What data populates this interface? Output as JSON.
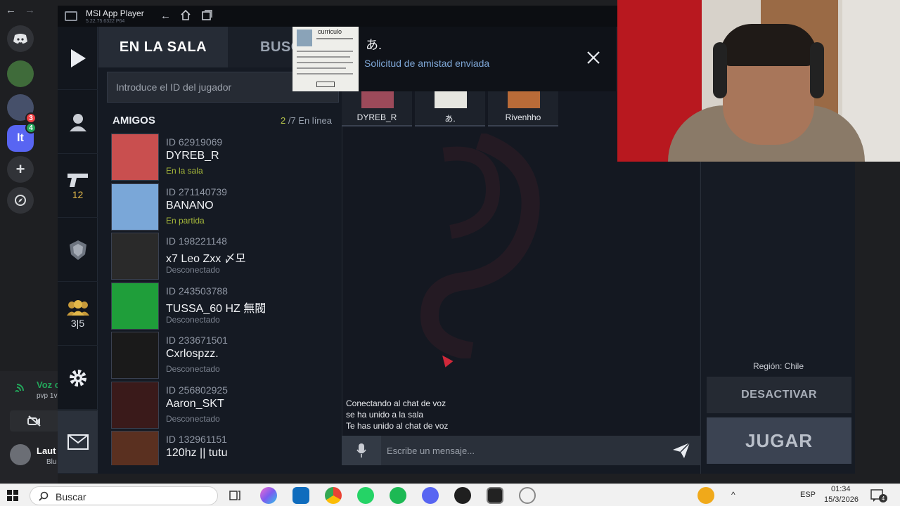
{
  "msi": {
    "title": "MSI App Player",
    "version": "5.22.75.6322 P64"
  },
  "discord": {
    "voice_title": "Voz c",
    "voice_sub": "pvp 1v",
    "user_name": "Laut",
    "user_status": "Blu"
  },
  "tabs": {
    "active": "EN LA SALA",
    "inactive": "BUSCA"
  },
  "search": {
    "placeholder": "Introduce el ID del jugador"
  },
  "rail": {
    "weapons_count": "12",
    "party_count": "3|5"
  },
  "friends": {
    "title": "AMIGOS",
    "online_current": "2",
    "online_total": "/7 En línea",
    "items": [
      {
        "id": "ID 62919069",
        "name": "DYREB_R",
        "status": "En la sala",
        "avatar_color": "#c94f4f"
      },
      {
        "id": "ID 271140739",
        "name": "BANANO",
        "status": "En partida",
        "avatar_color": "#7aa7d8"
      },
      {
        "id": "ID 198221148",
        "name": "x7 Leo Zxx 〆모",
        "status": "Desconectado",
        "avatar_color": "#2a2a2a"
      },
      {
        "id": "ID 243503788",
        "name": "TUSSA_60 HZ 無閥",
        "status": "Desconectado",
        "avatar_color": "#1f9e3a"
      },
      {
        "id": "ID 233671501",
        "name": "Cxrlospzz.",
        "status": "Desconectado",
        "avatar_color": "#1a1a1a"
      },
      {
        "id": "ID 256802925",
        "name": "Aaron_SKT",
        "status": "Desconectado",
        "avatar_color": "#3a1a1a"
      },
      {
        "id": "ID 132961151",
        "name": "120hz || tutu",
        "status": "",
        "avatar_color": "#5a3020"
      }
    ]
  },
  "room": {
    "slots": [
      {
        "name": "DYREB_R",
        "thumb_color": "#9c4a5a"
      },
      {
        "name": "あ.",
        "thumb_color": "#e6e6e0"
      },
      {
        "name": "Rivenhho",
        "thumb_color": "#b96b38"
      }
    ]
  },
  "chat": {
    "messages": [
      "Conectando al chat de voz",
      "se ha unido a la sala",
      "Te has unido al chat de voz"
    ],
    "input_placeholder": "Escribe un mensaje..."
  },
  "panel": {
    "region": "Región: Chile",
    "deactivate": "DESACTIVAR",
    "play": "JUGAR"
  },
  "notification": {
    "name": "あ.",
    "message": "Solicitud de amistad enviada",
    "thumb_caption": "curriculo"
  },
  "taskbar": {
    "search_label": "Buscar",
    "lang": "ESP",
    "time": "01:34",
    "date": "15/3/2026",
    "notif_count": "4"
  }
}
